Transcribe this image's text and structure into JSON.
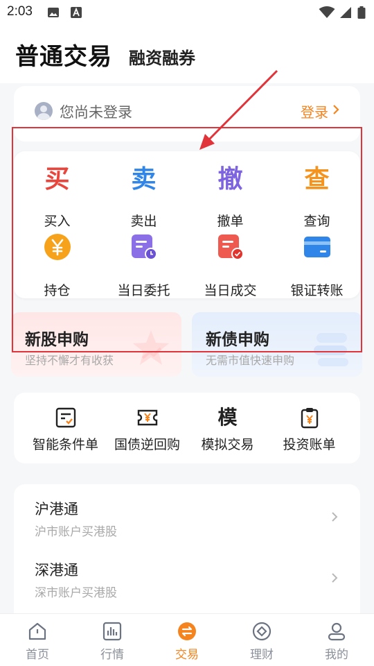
{
  "status_bar": {
    "time": "2:03"
  },
  "header": {
    "tab_main": "普通交易",
    "tab_margin": "融资融券"
  },
  "login": {
    "text": "您尚未登录",
    "link": "登录"
  },
  "functions": [
    {
      "glyph": "买",
      "label": "买入",
      "color": "#e8453c"
    },
    {
      "glyph": "卖",
      "label": "卖出",
      "color": "#2f86e8"
    },
    {
      "glyph": "撤",
      "label": "撤单",
      "color": "#7d63e0"
    },
    {
      "glyph": "查",
      "label": "查询",
      "color": "#f5931f"
    },
    {
      "label": "持仓",
      "icon": "yen-coin-icon",
      "color": "#f7a21b"
    },
    {
      "label": "当日委托",
      "icon": "order-clock-icon",
      "color": "#7d63e0"
    },
    {
      "label": "当日成交",
      "icon": "deal-check-icon",
      "color": "#ef4a44"
    },
    {
      "label": "银证转账",
      "icon": "bank-card-icon",
      "color": "#2f86e8"
    }
  ],
  "promos": {
    "stock": {
      "title": "新股申购",
      "subtitle": "坚持不懈才有收获"
    },
    "bond": {
      "title": "新债申购",
      "subtitle": "无需市值快速申购"
    }
  },
  "tools": [
    {
      "label": "智能条件单",
      "icon": "condition-order-icon"
    },
    {
      "label": "国债逆回购",
      "icon": "repo-ticket-icon"
    },
    {
      "label": "模拟交易",
      "glyph": "模"
    },
    {
      "label": "投资账单",
      "icon": "bill-clipboard-icon"
    }
  ],
  "hk_connect": [
    {
      "title": "沪港通",
      "subtitle": "沪市账户买港股"
    },
    {
      "title": "深港通",
      "subtitle": "深市账户买港股"
    }
  ],
  "nav": [
    {
      "label": "首页",
      "icon": "home-icon"
    },
    {
      "label": "行情",
      "icon": "chart-icon"
    },
    {
      "label": "交易",
      "icon": "trade-icon",
      "active": true
    },
    {
      "label": "理财",
      "icon": "wealth-icon"
    },
    {
      "label": "我的",
      "icon": "profile-icon"
    }
  ],
  "colors": {
    "accent": "#f5841f",
    "highlight": "#e0333a"
  }
}
